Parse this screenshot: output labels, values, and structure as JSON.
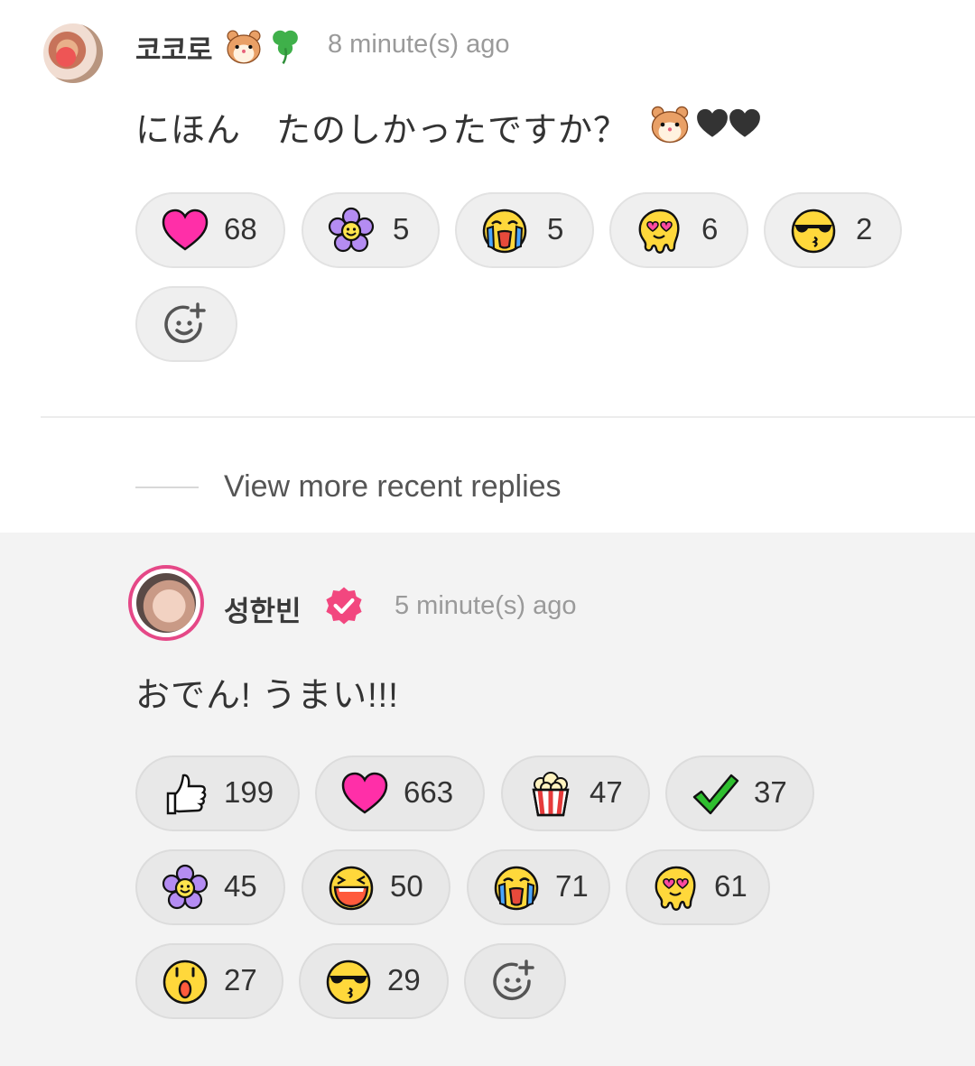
{
  "comment1": {
    "username": "코코로",
    "time": "8 minute(s) ago",
    "text": "にほん　たのしかったですか？",
    "reactions": [
      {
        "icon": "heart-icon",
        "count": "68"
      },
      {
        "icon": "flower-icon",
        "count": "5"
      },
      {
        "icon": "crying-face-icon",
        "count": "5"
      },
      {
        "icon": "melting-heart-eyes-icon",
        "count": "6"
      },
      {
        "icon": "sunglasses-kiss-icon",
        "count": "2"
      }
    ]
  },
  "more_replies": "View more recent replies",
  "comment2": {
    "username": "성한빈",
    "time": "5 minute(s) ago",
    "text": "おでん! うまい!!!",
    "reactions": [
      {
        "icon": "thumbs-up-icon",
        "count": "199"
      },
      {
        "icon": "heart-icon",
        "count": "663"
      },
      {
        "icon": "popcorn-icon",
        "count": "47"
      },
      {
        "icon": "checkmark-icon",
        "count": "37"
      },
      {
        "icon": "flower-icon",
        "count": "45"
      },
      {
        "icon": "laughing-face-icon",
        "count": "50"
      },
      {
        "icon": "crying-face-icon",
        "count": "71"
      },
      {
        "icon": "melting-heart-eyes-icon",
        "count": "61"
      },
      {
        "icon": "surprised-face-icon",
        "count": "27"
      },
      {
        "icon": "sunglasses-kiss-icon",
        "count": "29"
      }
    ]
  },
  "colors": {
    "accent_pink": "#e54887",
    "heart": "#ff2fa8",
    "pill_bg": "#efefef",
    "gray_section": "#f3f3f3"
  }
}
